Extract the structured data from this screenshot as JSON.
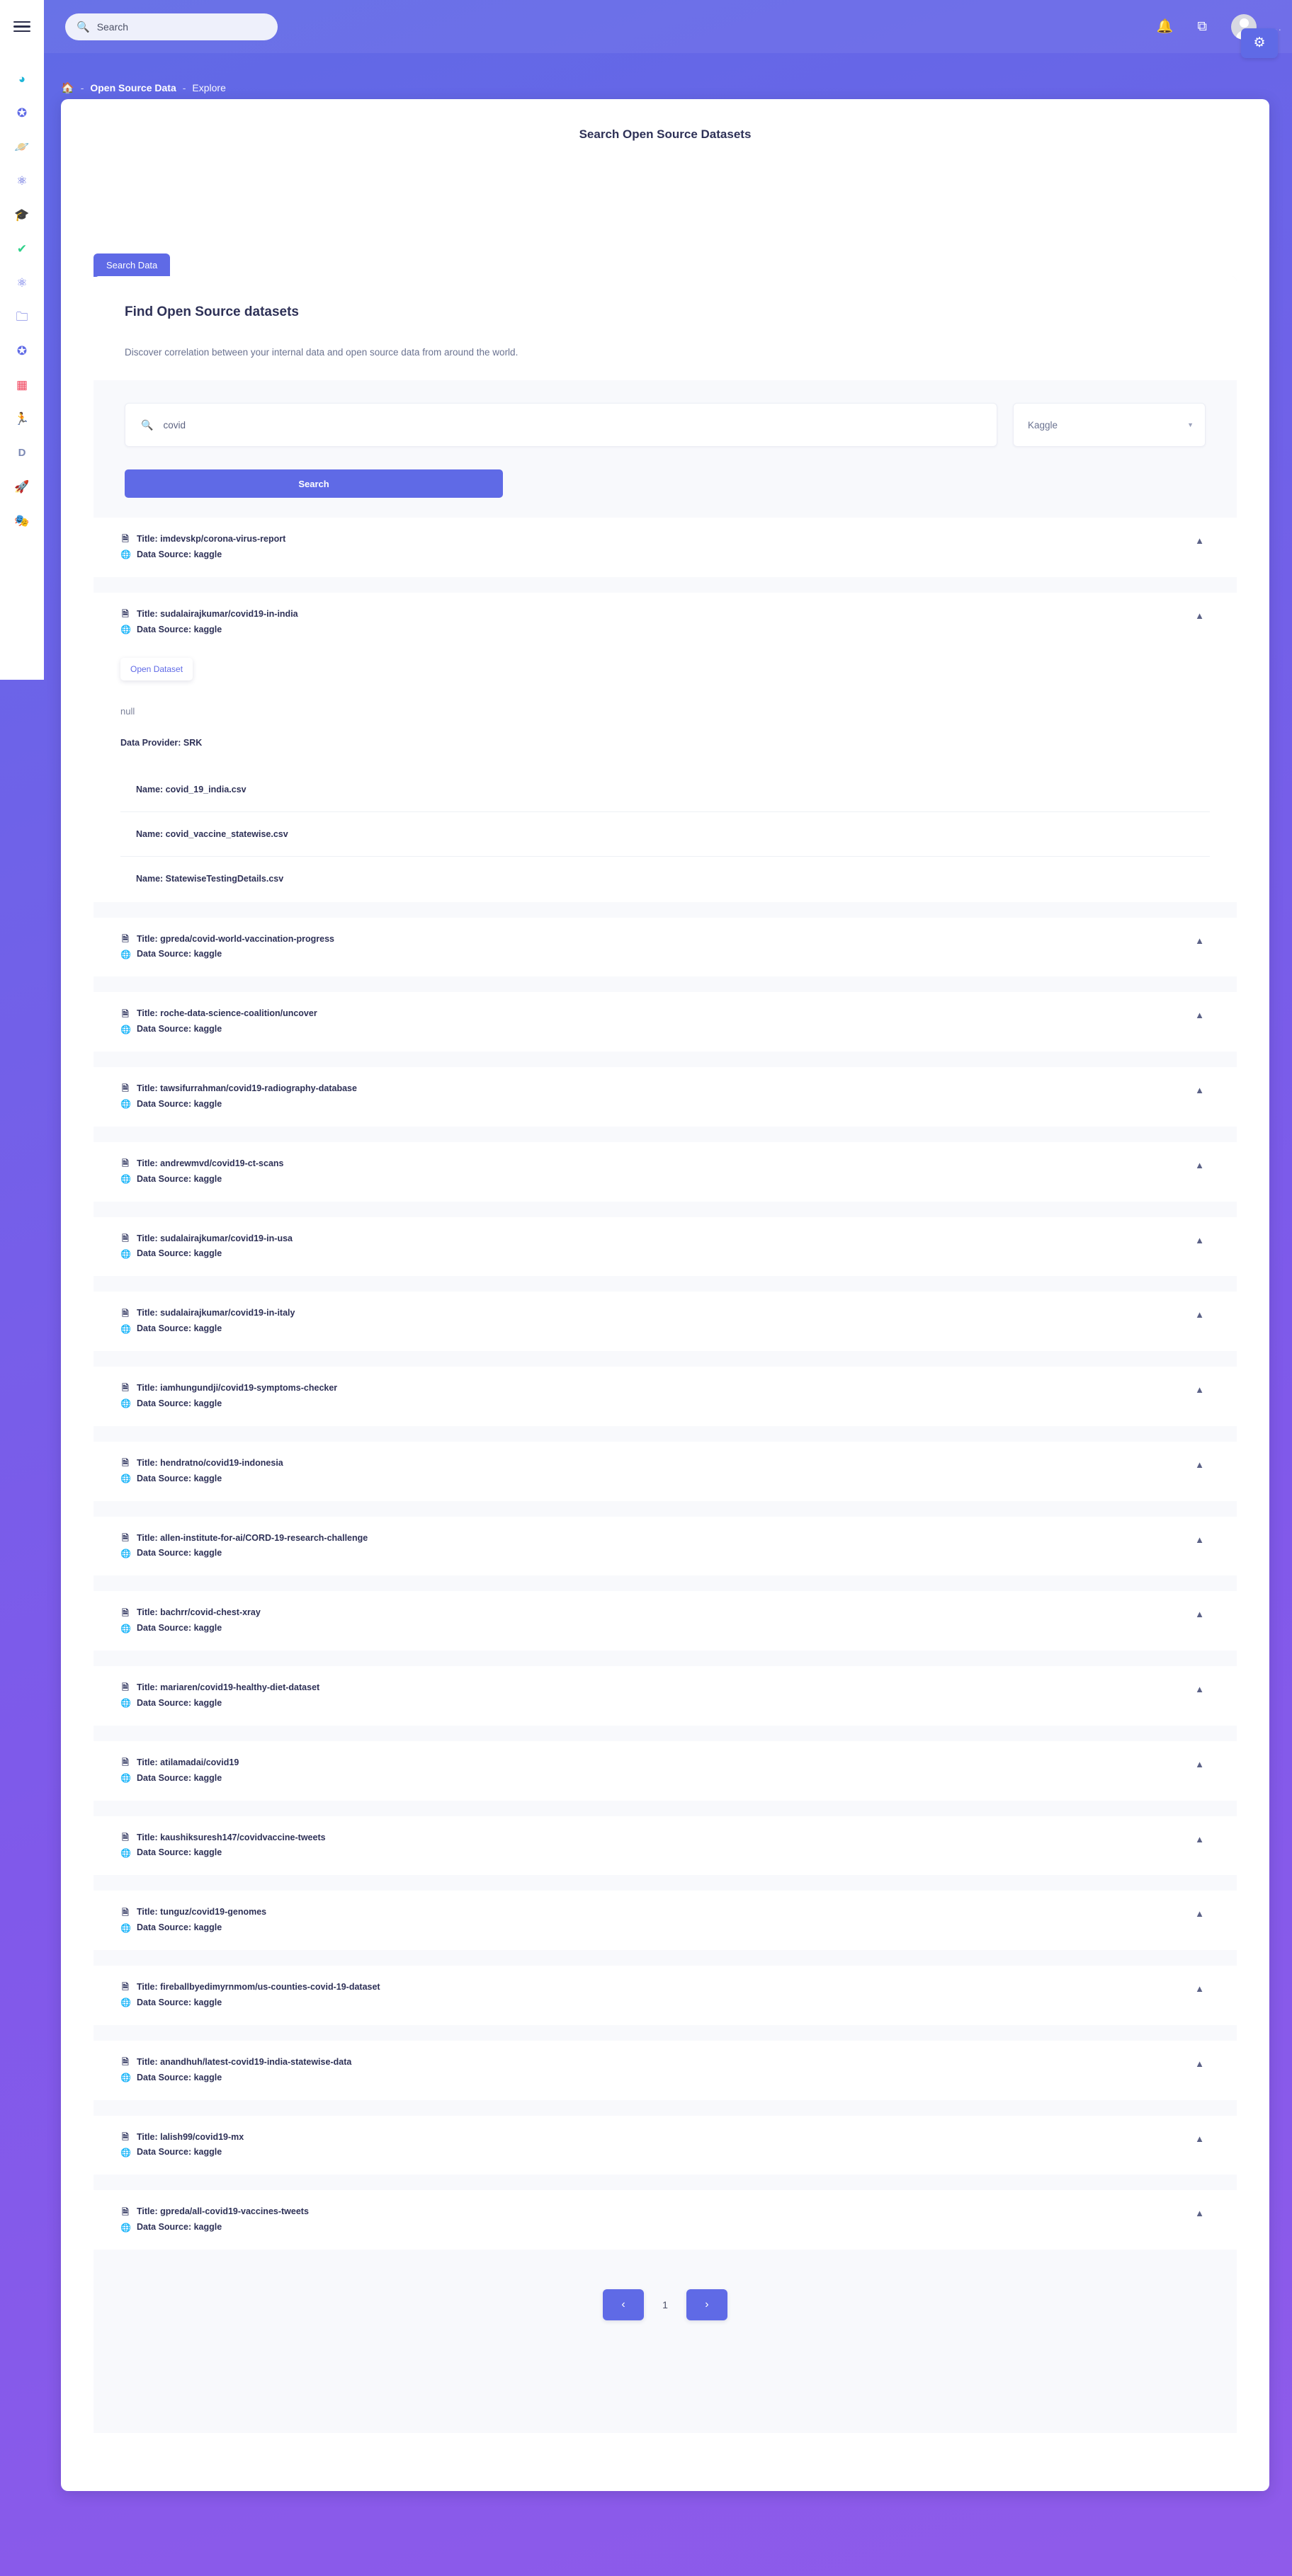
{
  "theme": {
    "accent": "#5f6ae6",
    "page_bg_gradient_from": "#5f6ae6",
    "page_bg_gradient_to": "#8f5bea",
    "text_dark": "#2e3157"
  },
  "topbar": {
    "search_placeholder": "Search",
    "search_icon": "search-icon",
    "menu_icon": "hamburger-menu-icon",
    "notification_icon": "bell-icon",
    "windows_icon": "copy-windows-icon",
    "avatar_icon": "user-avatar",
    "settings_icon": "gear-icon",
    "overflow_dots": "···"
  },
  "sidebar": {
    "items": [
      {
        "icon": "pie-chart-icon",
        "glyph": "◕",
        "color": "#1fb6d8"
      },
      {
        "icon": "compass-icon",
        "glyph": "✪",
        "color": "#5f6ae6"
      },
      {
        "icon": "planet-icon",
        "glyph": "🪐",
        "color": "#5f6ae6"
      },
      {
        "icon": "atom-settings-icon",
        "glyph": "⚛",
        "color": "#4a54d8"
      },
      {
        "icon": "graduation-cap-icon",
        "glyph": "🎓",
        "color": "#1fb6d8"
      },
      {
        "icon": "check-icon",
        "glyph": "✔",
        "color": "#2fd18a"
      },
      {
        "icon": "atom-icon",
        "glyph": "⚛",
        "color": "#5f6ae6"
      },
      {
        "icon": "folder-icon",
        "glyph": "🗀",
        "color": "#4a54d8"
      },
      {
        "icon": "compass-explore-icon",
        "glyph": "✪",
        "color": "#5f6ae6"
      },
      {
        "icon": "calendar-icon",
        "glyph": "▦",
        "color": "#f0455e"
      },
      {
        "icon": "runner-icon",
        "glyph": "🏃",
        "color": "#f0455e"
      },
      {
        "icon": "letter-d-icon",
        "glyph": "D",
        "color": "#7c89b4"
      },
      {
        "icon": "rocket-icon",
        "glyph": "🚀",
        "color": "#3a3f55"
      },
      {
        "icon": "mask-icon",
        "glyph": "🎭",
        "color": "#3a3f55"
      }
    ]
  },
  "breadcrumb": {
    "home_icon": "home-icon",
    "separator": "-",
    "item1": "Open Source Data",
    "item2": "Explore"
  },
  "page": {
    "title": "Search Open Source Datasets"
  },
  "tabs": [
    {
      "label": "Search Data",
      "active": true
    }
  ],
  "panel": {
    "heading": "Find Open Source datasets",
    "subheading": "Discover correlation between your internal data and open source data from around the world.",
    "search": {
      "icon": "search-icon",
      "value": "covid",
      "placeholder": "Search"
    },
    "source_select": {
      "value": "Kaggle",
      "chevron": "chevron-down-icon"
    },
    "search_button": "Search"
  },
  "labels": {
    "title_prefix": "Title: ",
    "source_prefix": "Data Source: ",
    "name_prefix": "Name: ",
    "title_icon": "folder-file-icon",
    "source_icon": "globe-icon",
    "collapse_icon": "chevron-up-icon",
    "open_dataset": "Open Dataset",
    "description_value": "null",
    "provider_label": "Data Provider: SRK"
  },
  "results": [
    {
      "title": "imdevskp/corona-virus-report",
      "source": "kaggle",
      "expanded": false
    },
    {
      "title": "sudalairajkumar/covid19-in-india",
      "source": "kaggle",
      "expanded": true,
      "description": "null",
      "provider": "Data Provider: SRK",
      "files": [
        "Name: covid_19_india.csv",
        "Name: covid_vaccine_statewise.csv",
        "Name: StatewiseTestingDetails.csv"
      ]
    },
    {
      "title": "gpreda/covid-world-vaccination-progress",
      "source": "kaggle",
      "expanded": false
    },
    {
      "title": "roche-data-science-coalition/uncover",
      "source": "kaggle",
      "expanded": false
    },
    {
      "title": "tawsifurrahman/covid19-radiography-database",
      "source": "kaggle",
      "expanded": false
    },
    {
      "title": "andrewmvd/covid19-ct-scans",
      "source": "kaggle",
      "expanded": false
    },
    {
      "title": "sudalairajkumar/covid19-in-usa",
      "source": "kaggle",
      "expanded": false
    },
    {
      "title": "sudalairajkumar/covid19-in-italy",
      "source": "kaggle",
      "expanded": false
    },
    {
      "title": "iamhungundji/covid19-symptoms-checker",
      "source": "kaggle",
      "expanded": false
    },
    {
      "title": "hendratno/covid19-indonesia",
      "source": "kaggle",
      "expanded": false
    },
    {
      "title": "allen-institute-for-ai/CORD-19-research-challenge",
      "source": "kaggle",
      "expanded": false
    },
    {
      "title": "bachrr/covid-chest-xray",
      "source": "kaggle",
      "expanded": false
    },
    {
      "title": "mariaren/covid19-healthy-diet-dataset",
      "source": "kaggle",
      "expanded": false
    },
    {
      "title": "atilamadai/covid19",
      "source": "kaggle",
      "expanded": false
    },
    {
      "title": "kaushiksuresh147/covidvaccine-tweets",
      "source": "kaggle",
      "expanded": false
    },
    {
      "title": "tunguz/covid19-genomes",
      "source": "kaggle",
      "expanded": false
    },
    {
      "title": "fireballbyedimyrnmom/us-counties-covid-19-dataset",
      "source": "kaggle",
      "expanded": false
    },
    {
      "title": "anandhuh/latest-covid19-india-statewise-data",
      "source": "kaggle",
      "expanded": false
    },
    {
      "title": "lalish99/covid19-mx",
      "source": "kaggle",
      "expanded": false
    },
    {
      "title": "gpreda/all-covid19-vaccines-tweets",
      "source": "kaggle",
      "expanded": false
    }
  ],
  "pagination": {
    "prev": "‹",
    "page": "1",
    "next": "›"
  }
}
